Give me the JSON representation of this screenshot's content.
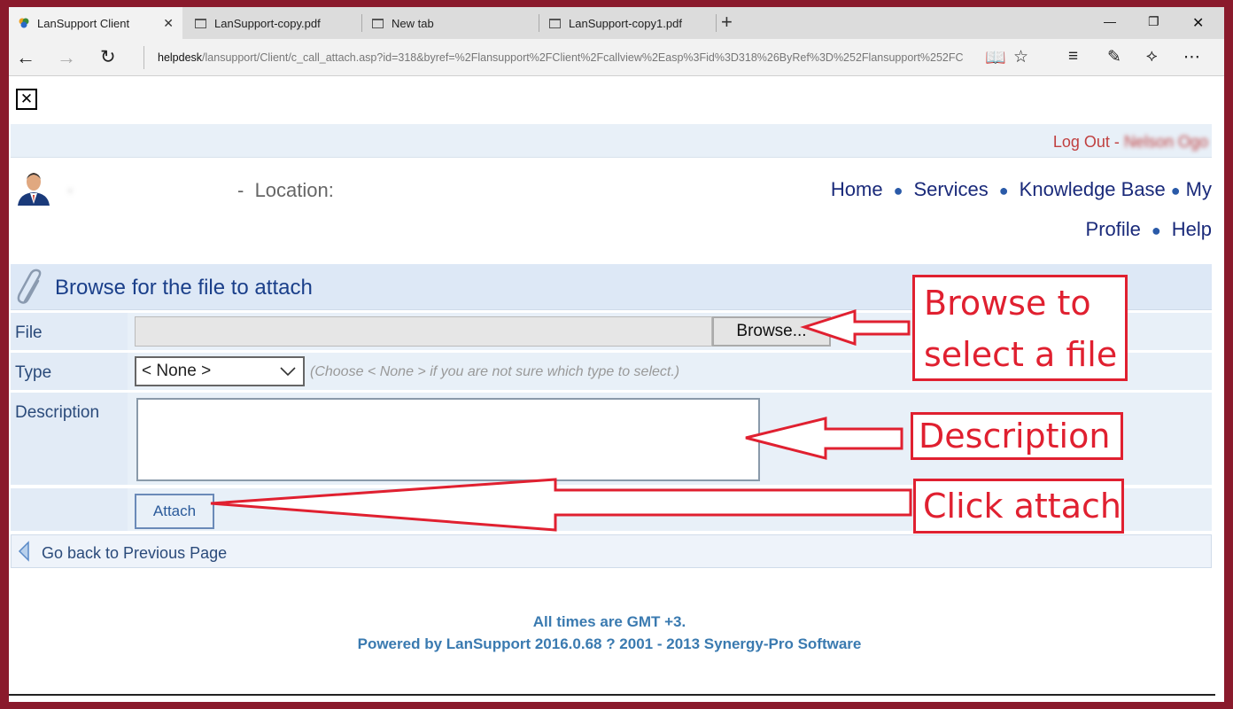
{
  "browser": {
    "tabs": [
      {
        "label": "LanSupport Client",
        "active": true
      },
      {
        "label": "LanSupport-copy.pdf",
        "active": false
      },
      {
        "label": "New tab",
        "active": false
      },
      {
        "label": "LanSupport-copy1.pdf",
        "active": false
      }
    ],
    "url_host": "helpdesk",
    "url_path": "/lansupport/Client/c_call_attach.asp?id=318&byref=%2Flansupport%2FClient%2Fcallview%2Easp%3Fid%3D318%26ByRef%3D%252Flansupport%252FC"
  },
  "page": {
    "close_symbol": "✕",
    "logout": {
      "label": "Log Out -",
      "user": "Nelson Ogo"
    },
    "header": {
      "name": "·",
      "separator": "-",
      "location_label": "Location:"
    },
    "nav": [
      "Home",
      "Services",
      "Knowledge Base",
      "My Profile",
      "Help"
    ],
    "title": "Browse for the file to attach",
    "form": {
      "file_label": "File",
      "browse_label": "Browse...",
      "type_label": "Type",
      "type_value": "< None >",
      "type_hint": "(Choose < None > if you are not sure which type to select.)",
      "description_label": "Description",
      "attach_label": "Attach"
    },
    "back_link": "Go back to Previous Page",
    "footer": {
      "line1": "All times are GMT +3.",
      "line2": "Powered by LanSupport 2016.0.68 ? 2001 - 2013 Synergy-Pro Software"
    }
  },
  "annotations": {
    "browse": {
      "line1": "Browse to",
      "line2": "select a file"
    },
    "description": "Description",
    "attach": "Click attach",
    "color": "#e02030"
  }
}
